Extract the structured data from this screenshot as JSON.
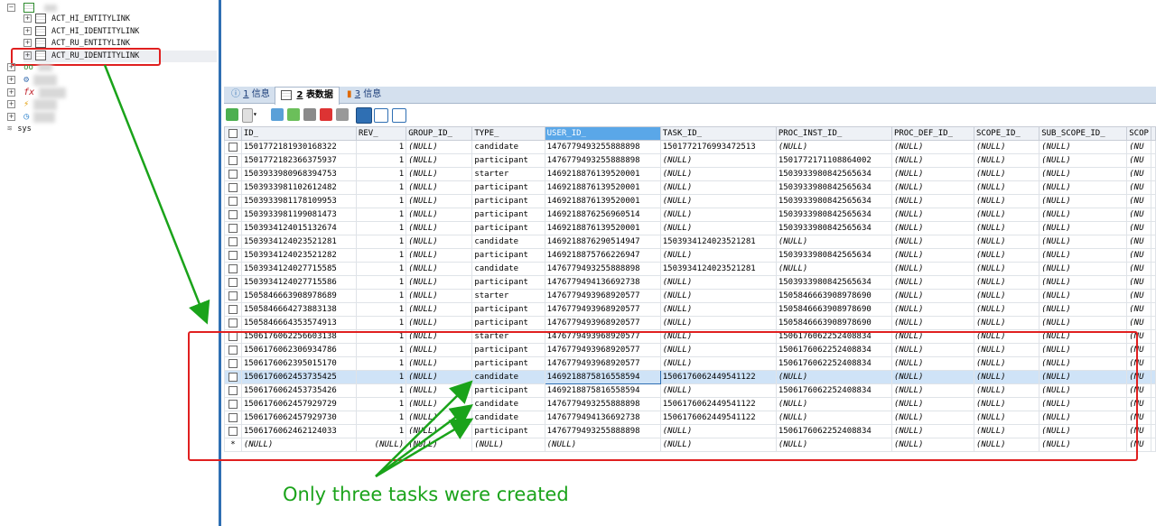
{
  "sidebar": {
    "tables": [
      "ACT_HI_ENTITYLINK",
      "ACT_HI_IDENTITYLINK",
      "ACT_RU_ENTITYLINK",
      "ACT_RU_IDENTITYLINK"
    ],
    "db_label": "sys"
  },
  "tabs": [
    {
      "num": "1",
      "label": "信息"
    },
    {
      "num": "2",
      "label": "表数据"
    },
    {
      "num": "3",
      "label": "信息"
    }
  ],
  "columns": [
    "ID_",
    "REV_",
    "GROUP_ID_",
    "TYPE_",
    "USER_ID_",
    "TASK_ID_",
    "PROC_INST_ID_",
    "PROC_DEF_ID_",
    "SCOPE_ID_",
    "SUB_SCOPE_ID_",
    "SCOP"
  ],
  "rows": [
    [
      "1501772181930168322",
      "1",
      "(NULL)",
      "candidate",
      "1476779493255888898",
      "1501772176993472513",
      "(NULL)",
      "(NULL)",
      "(NULL)",
      "(NULL)",
      "(NU"
    ],
    [
      "1501772182366375937",
      "1",
      "(NULL)",
      "participant",
      "1476779493255888898",
      "(NULL)",
      "1501772171108864002",
      "(NULL)",
      "(NULL)",
      "(NULL)",
      "(NU"
    ],
    [
      "1503933980968394753",
      "1",
      "(NULL)",
      "starter",
      "1469218876139520001",
      "(NULL)",
      "1503933980842565634",
      "(NULL)",
      "(NULL)",
      "(NULL)",
      "(NU"
    ],
    [
      "1503933981102612482",
      "1",
      "(NULL)",
      "participant",
      "1469218876139520001",
      "(NULL)",
      "1503933980842565634",
      "(NULL)",
      "(NULL)",
      "(NULL)",
      "(NU"
    ],
    [
      "1503933981178109953",
      "1",
      "(NULL)",
      "participant",
      "1469218876139520001",
      "(NULL)",
      "1503933980842565634",
      "(NULL)",
      "(NULL)",
      "(NULL)",
      "(NU"
    ],
    [
      "1503933981199081473",
      "1",
      "(NULL)",
      "participant",
      "1469218876256960514",
      "(NULL)",
      "1503933980842565634",
      "(NULL)",
      "(NULL)",
      "(NULL)",
      "(NU"
    ],
    [
      "1503934124015132674",
      "1",
      "(NULL)",
      "participant",
      "1469218876139520001",
      "(NULL)",
      "1503933980842565634",
      "(NULL)",
      "(NULL)",
      "(NULL)",
      "(NU"
    ],
    [
      "1503934124023521281",
      "1",
      "(NULL)",
      "candidate",
      "1469218876290514947",
      "1503934124023521281",
      "(NULL)",
      "(NULL)",
      "(NULL)",
      "(NULL)",
      "(NU"
    ],
    [
      "1503934124023521282",
      "1",
      "(NULL)",
      "participant",
      "1469218875766226947",
      "(NULL)",
      "1503933980842565634",
      "(NULL)",
      "(NULL)",
      "(NULL)",
      "(NU"
    ],
    [
      "1503934124027715585",
      "1",
      "(NULL)",
      "candidate",
      "1476779493255888898",
      "1503934124023521281",
      "(NULL)",
      "(NULL)",
      "(NULL)",
      "(NULL)",
      "(NU"
    ],
    [
      "1503934124027715586",
      "1",
      "(NULL)",
      "participant",
      "1476779494136692738",
      "(NULL)",
      "1503933980842565634",
      "(NULL)",
      "(NULL)",
      "(NULL)",
      "(NU"
    ],
    [
      "1505846663908978689",
      "1",
      "(NULL)",
      "starter",
      "1476779493968920577",
      "(NULL)",
      "1505846663908978690",
      "(NULL)",
      "(NULL)",
      "(NULL)",
      "(NU"
    ],
    [
      "1505846664273883138",
      "1",
      "(NULL)",
      "participant",
      "1476779493968920577",
      "(NULL)",
      "1505846663908978690",
      "(NULL)",
      "(NULL)",
      "(NULL)",
      "(NU"
    ],
    [
      "1505846664353574913",
      "1",
      "(NULL)",
      "participant",
      "1476779493968920577",
      "(NULL)",
      "1505846663908978690",
      "(NULL)",
      "(NULL)",
      "(NULL)",
      "(NU"
    ],
    [
      "1506176062256603138",
      "1",
      "(NULL)",
      "starter",
      "1476779493968920577",
      "(NULL)",
      "1506176062252408834",
      "(NULL)",
      "(NULL)",
      "(NULL)",
      "(NU"
    ],
    [
      "1506176062306934786",
      "1",
      "(NULL)",
      "participant",
      "1476779493968920577",
      "(NULL)",
      "1506176062252408834",
      "(NULL)",
      "(NULL)",
      "(NULL)",
      "(NU"
    ],
    [
      "1506176062395015170",
      "1",
      "(NULL)",
      "participant",
      "1476779493968920577",
      "(NULL)",
      "1506176062252408834",
      "(NULL)",
      "(NULL)",
      "(NULL)",
      "(NU"
    ],
    [
      "1506176062453735425",
      "1",
      "(NULL)",
      "candidate",
      "1469218875816558594",
      "1506176062449541122",
      "(NULL)",
      "(NULL)",
      "(NULL)",
      "(NULL)",
      "(NU"
    ],
    [
      "1506176062453735426",
      "1",
      "(NULL)",
      "participant",
      "1469218875816558594",
      "(NULL)",
      "1506176062252408834",
      "(NULL)",
      "(NULL)",
      "(NULL)",
      "(NU"
    ],
    [
      "1506176062457929729",
      "1",
      "(NULL)",
      "candidate",
      "1476779493255888898",
      "1506176062449541122",
      "(NULL)",
      "(NULL)",
      "(NULL)",
      "(NULL)",
      "(NU"
    ],
    [
      "1506176062457929730",
      "1",
      "(NULL)",
      "candidate",
      "1476779494136692738",
      "1506176062449541122",
      "(NULL)",
      "(NULL)",
      "(NULL)",
      "(NULL)",
      "(NU"
    ],
    [
      "1506176062462124033",
      "1",
      "(NULL)",
      "participant",
      "1476779493255888898",
      "(NULL)",
      "1506176062252408834",
      "(NULL)",
      "(NULL)",
      "(NULL)",
      "(NU"
    ]
  ],
  "new_row": [
    "(NULL)",
    "(NULL)",
    "(NULL)",
    "(NULL)",
    "(NULL)",
    "(NULL)",
    "(NULL)",
    "(NULL)",
    "(NULL)",
    "(NULL)",
    "(NU"
  ],
  "new_row_marker": "*",
  "selected_row_index": 17,
  "annotation": "Only three tasks were created",
  "colors": {
    "highlight_red": "#e02020",
    "arrow_green": "#1aa31a",
    "selection_blue": "#cfe3f7",
    "header_selected": "#5aa7e8"
  }
}
